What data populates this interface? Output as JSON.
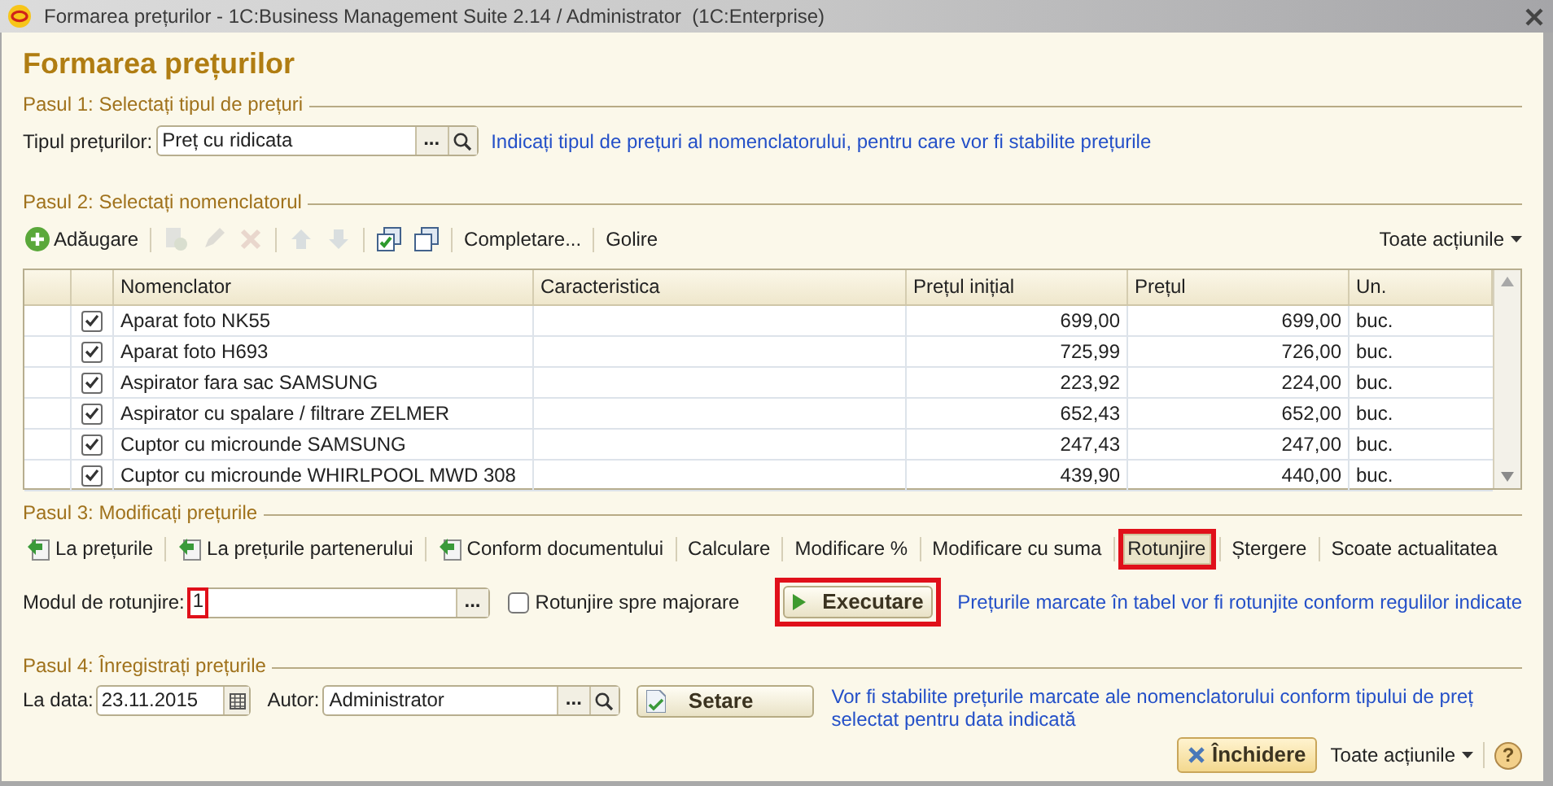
{
  "window": {
    "title": "Formarea prețurilor - 1C:Business Management Suite 2.14 / Administrator  (1C:Enterprise)"
  },
  "heading": "Formarea prețurilor",
  "step1": {
    "title": "Pasul 1: Selectați tipul de prețuri",
    "label": "Tipul prețurilor:",
    "value": "Preț cu ridicata",
    "choose_button": "...",
    "hint": "Indicați tipul de prețuri al nomenclatorului, pentru care vor fi stabilite prețurile"
  },
  "step2": {
    "title": "Pasul 2: Selectați nomenclatorul",
    "toolbar": [
      {
        "kind": "add",
        "label": "Adăugare",
        "disabled": false
      },
      {
        "kind": "separator"
      },
      {
        "kind": "copy",
        "disabled": true
      },
      {
        "kind": "edit",
        "disabled": true
      },
      {
        "kind": "delete",
        "disabled": true
      },
      {
        "kind": "separator"
      },
      {
        "kind": "up",
        "disabled": true
      },
      {
        "kind": "down",
        "disabled": true
      },
      {
        "kind": "separator"
      },
      {
        "kind": "check-all",
        "disabled": false
      },
      {
        "kind": "uncheck-all",
        "disabled": false
      },
      {
        "kind": "separator"
      },
      {
        "kind": "text",
        "label": "Completare...",
        "disabled": false
      },
      {
        "kind": "separator"
      },
      {
        "kind": "text",
        "label": "Golire",
        "disabled": false
      }
    ],
    "all_actions": "Toate acțiunile",
    "table": {
      "columns": [
        "Nomenclator",
        "Caracteristica",
        "Prețul inițial",
        "Prețul",
        "Un."
      ],
      "rows": [
        {
          "checked": true,
          "item": "Aparat foto NK55",
          "initial_price": "699,00",
          "price": "699,00",
          "unit": "buc."
        },
        {
          "checked": true,
          "item": "Aparat foto H693",
          "initial_price": "725,99",
          "price": "726,00",
          "unit": "buc."
        },
        {
          "checked": true,
          "item": "Aspirator  fara sac SAMSUNG",
          "initial_price": "223,92",
          "price": "224,00",
          "unit": "buc."
        },
        {
          "checked": true,
          "item": "Aspirator cu spalare / filtrare ZELMER",
          "initial_price": "652,43",
          "price": "652,00",
          "unit": "buc."
        },
        {
          "checked": true,
          "item": "Cuptor cu microunde SAMSUNG",
          "initial_price": "247,43",
          "price": "247,00",
          "unit": "buc."
        },
        {
          "checked": true,
          "item": "Cuptor cu microunde WHIRLPOOL MWD 308",
          "initial_price": "439,90",
          "price": "440,00",
          "unit": "buc."
        }
      ]
    }
  },
  "step3": {
    "title": "Pasul 3: Modificați prețurile",
    "actions": [
      {
        "kind": "icon-link",
        "label": "La prețurile",
        "selected": false,
        "annotated": false
      },
      {
        "kind": "icon-link",
        "label": "La prețurile partenerului",
        "selected": false,
        "annotated": false
      },
      {
        "kind": "icon-link",
        "label": "Conform documentului",
        "selected": false,
        "annotated": false
      },
      {
        "kind": "text",
        "label": "Calculare",
        "selected": false,
        "annotated": false
      },
      {
        "kind": "text",
        "label": "Modificare %",
        "selected": false,
        "annotated": false
      },
      {
        "kind": "text",
        "label": "Modificare cu suma",
        "selected": false,
        "annotated": false
      },
      {
        "kind": "text",
        "label": "Rotunjire",
        "selected": true,
        "annotated": true
      },
      {
        "kind": "text",
        "label": "Ștergere",
        "selected": false,
        "annotated": false
      },
      {
        "kind": "text",
        "label": "Scoate actualitatea",
        "selected": false,
        "annotated": false
      }
    ],
    "rounding": {
      "label": "Modul de rotunjire:",
      "value": "1",
      "choose_button": "...",
      "annotated": true
    },
    "round_up": {
      "label": "Rotunjire spre majorare",
      "checked": false
    },
    "execute": {
      "label": "Executare",
      "annotated": true
    },
    "hint": "Prețurile marcate în tabel vor fi rotunjite conform regulilor indicate"
  },
  "step4": {
    "title": "Pasul 4: Înregistrați prețurile",
    "date_label": "La data:",
    "date": "23.11.2015",
    "author_label": "Autor:",
    "author": "Administrator",
    "choose_button": "...",
    "button": "Setare",
    "hint": "Vor fi stabilite prețurile marcate ale nomenclatorului conform tipului de preț selectat pentru data indicată"
  },
  "footer": {
    "close": "Închidere",
    "all_actions": "Toate acțiunile",
    "help": "?"
  }
}
